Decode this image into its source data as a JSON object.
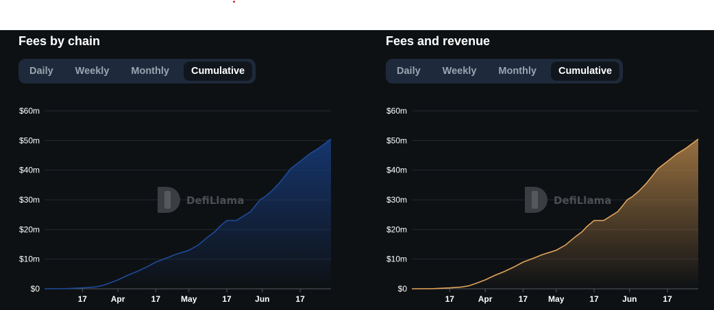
{
  "charts": [
    {
      "title": "Fees by chain",
      "tabs": [
        "Daily",
        "Weekly",
        "Monthly",
        "Cumulative"
      ],
      "active_tab": "Cumulative",
      "watermark": "DefiLlama",
      "color": "#1f4b9a",
      "fill_top": "#173a78"
    },
    {
      "title": "Fees and revenue",
      "tabs": [
        "Daily",
        "Weekly",
        "Monthly",
        "Cumulative"
      ],
      "active_tab": "Cumulative",
      "watermark": "DefiLlama",
      "color": "#e3a55c",
      "fill_top": "#a77a45"
    }
  ],
  "chart_data": [
    {
      "type": "area",
      "title": "Fees by chain",
      "ylim": [
        0,
        60
      ],
      "y_unit": "$m",
      "y_ticks": [
        "$0",
        "$10m",
        "$20m",
        "$30m",
        "$40m",
        "$50m",
        "$60m"
      ],
      "x_ticks": [
        {
          "date": "03-17",
          "label": "17",
          "bold": false
        },
        {
          "date": "04-01",
          "label": "Apr",
          "bold": true
        },
        {
          "date": "04-17",
          "label": "17",
          "bold": false
        },
        {
          "date": "05-01",
          "label": "May",
          "bold": true
        },
        {
          "date": "05-17",
          "label": "17",
          "bold": false
        },
        {
          "date": "06-01",
          "label": "Jun",
          "bold": true
        },
        {
          "date": "06-17",
          "label": "17",
          "bold": false
        }
      ],
      "xlim": [
        "03-01",
        "06-30"
      ],
      "grid": true,
      "series": [
        {
          "x": [
            "03-01",
            "03-10",
            "03-17",
            "03-22",
            "03-25",
            "03-28",
            "04-01",
            "04-05",
            "04-09",
            "04-13",
            "04-17",
            "04-22",
            "04-25",
            "05-01",
            "05-05",
            "05-09",
            "05-12",
            "05-14",
            "05-17",
            "05-21",
            "05-24",
            "05-27",
            "05-29",
            "05-31",
            "06-02",
            "06-05",
            "06-08",
            "06-11",
            "06-13",
            "06-17",
            "06-21",
            "06-25",
            "06-30"
          ],
          "y": [
            0,
            0.05,
            0.3,
            0.6,
            1.0,
            1.8,
            3.0,
            4.5,
            5.8,
            7.3,
            9.0,
            10.5,
            11.5,
            13.0,
            14.8,
            17.5,
            19.3,
            21.0,
            23.0,
            23.0,
            24.5,
            26.0,
            28.0,
            30.0,
            31.0,
            33.0,
            35.5,
            38.5,
            40.5,
            43.0,
            45.5,
            47.5,
            50.5
          ]
        }
      ]
    },
    {
      "type": "area",
      "title": "Fees and revenue",
      "ylim": [
        0,
        60
      ],
      "y_unit": "$m",
      "y_ticks": [
        "$0",
        "$10m",
        "$20m",
        "$30m",
        "$40m",
        "$50m",
        "$60m"
      ],
      "x_ticks": [
        {
          "date": "03-17",
          "label": "17",
          "bold": false
        },
        {
          "date": "04-01",
          "label": "Apr",
          "bold": true
        },
        {
          "date": "04-17",
          "label": "17",
          "bold": false
        },
        {
          "date": "05-01",
          "label": "May",
          "bold": true
        },
        {
          "date": "05-17",
          "label": "17",
          "bold": false
        },
        {
          "date": "06-01",
          "label": "Jun",
          "bold": true
        },
        {
          "date": "06-17",
          "label": "17",
          "bold": false
        }
      ],
      "xlim": [
        "03-01",
        "06-30"
      ],
      "grid": true,
      "series": [
        {
          "x": [
            "03-01",
            "03-10",
            "03-17",
            "03-22",
            "03-25",
            "03-28",
            "04-01",
            "04-05",
            "04-09",
            "04-13",
            "04-17",
            "04-22",
            "04-25",
            "05-01",
            "05-05",
            "05-09",
            "05-12",
            "05-14",
            "05-17",
            "05-21",
            "05-24",
            "05-27",
            "05-29",
            "05-31",
            "06-02",
            "06-05",
            "06-08",
            "06-11",
            "06-13",
            "06-17",
            "06-21",
            "06-25",
            "06-30"
          ],
          "y": [
            0,
            0.05,
            0.3,
            0.6,
            1.0,
            1.8,
            3.0,
            4.5,
            5.8,
            7.3,
            9.0,
            10.5,
            11.5,
            13.0,
            14.8,
            17.5,
            19.3,
            21.0,
            23.0,
            23.0,
            24.5,
            26.0,
            28.0,
            30.0,
            31.0,
            33.0,
            35.5,
            38.5,
            40.5,
            43.0,
            45.5,
            47.5,
            50.5
          ]
        }
      ]
    }
  ]
}
